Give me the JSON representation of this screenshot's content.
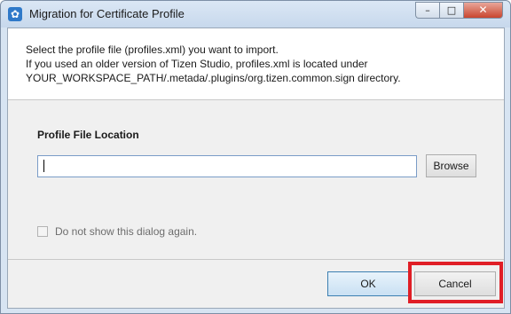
{
  "window": {
    "title": "Migration for Certificate Profile",
    "app_icon": "certificate-icon",
    "controls": {
      "minimize_glyph": "–",
      "maximize_glyph": "□",
      "close_glyph": "✕"
    }
  },
  "description": {
    "line1": "Select the profile file (profiles.xml) you want to import.",
    "line2": "If you used an older version of Tizen Studio, profiles.xml is located under",
    "line3": " YOUR_WORKSPACE_PATH/.metada/.plugins/org.tizen.common.sign directory."
  },
  "profile_location": {
    "label": "Profile File Location",
    "value": "",
    "browse_label": "Browse"
  },
  "dont_show": {
    "label": "Do not show this dialog again.",
    "checked": false
  },
  "footer": {
    "ok_label": "OK",
    "cancel_label": "Cancel"
  },
  "colors": {
    "highlight": "#e01e26",
    "ok_border": "#3c7fb1"
  }
}
